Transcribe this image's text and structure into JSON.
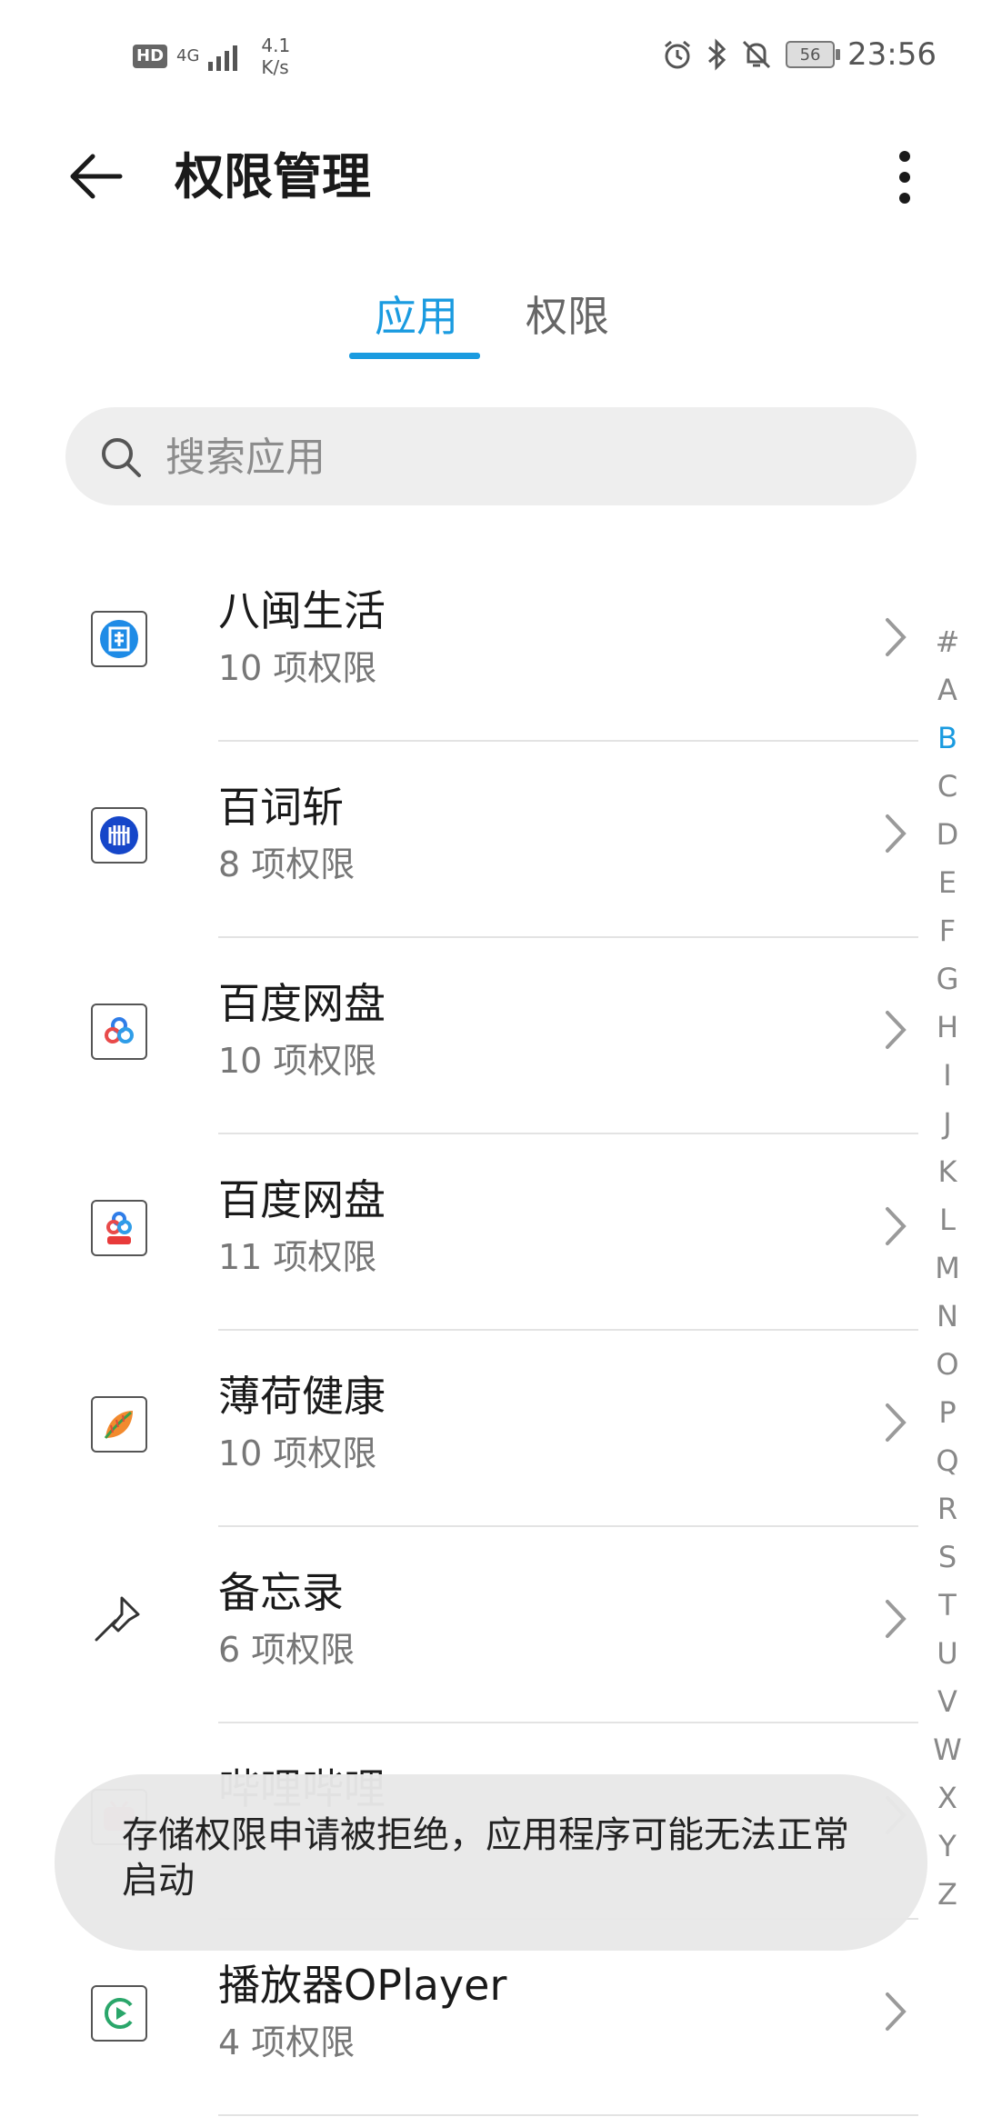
{
  "status_bar": {
    "hd": "HD",
    "network": "4G",
    "speed_value": "4.1",
    "speed_unit": "K/s",
    "battery": "56",
    "time": "23:56"
  },
  "header": {
    "title": "权限管理"
  },
  "tabs": [
    {
      "label": "应用",
      "active": true
    },
    {
      "label": "权限",
      "active": false
    }
  ],
  "search": {
    "placeholder": "搜索应用"
  },
  "apps": [
    {
      "name": "八闽生活",
      "perms": "10 项权限",
      "icon": "bamin-app-icon"
    },
    {
      "name": "百词斩",
      "perms": "8 项权限",
      "icon": "baicizhan-app-icon"
    },
    {
      "name": "百度网盘",
      "perms": "10 项权限",
      "icon": "baidu-netdisk-app-icon"
    },
    {
      "name": "百度网盘",
      "perms": "11 项权限",
      "icon": "baidu-netdisk-app-icon"
    },
    {
      "name": "薄荷健康",
      "perms": "10 项权限",
      "icon": "mint-health-app-icon"
    },
    {
      "name": "备忘录",
      "perms": "6 项权限",
      "icon": "pin-icon"
    },
    {
      "name": "哔哩哔哩",
      "perms": "",
      "icon": "bilibili-app-icon"
    },
    {
      "name": "播放器OPlayer",
      "perms": "4 项权限",
      "icon": "oplayer-app-icon"
    }
  ],
  "index_letters": [
    "#",
    "A",
    "B",
    "C",
    "D",
    "E",
    "F",
    "G",
    "H",
    "I",
    "J",
    "K",
    "L",
    "M",
    "N",
    "O",
    "P",
    "Q",
    "R",
    "S",
    "T",
    "U",
    "V",
    "W",
    "X",
    "Y",
    "Z"
  ],
  "index_active": "B",
  "toast": {
    "text": "存储权限申请被拒绝，应用程序可能无法正常启动"
  },
  "colors": {
    "accent": "#1a9be0"
  }
}
